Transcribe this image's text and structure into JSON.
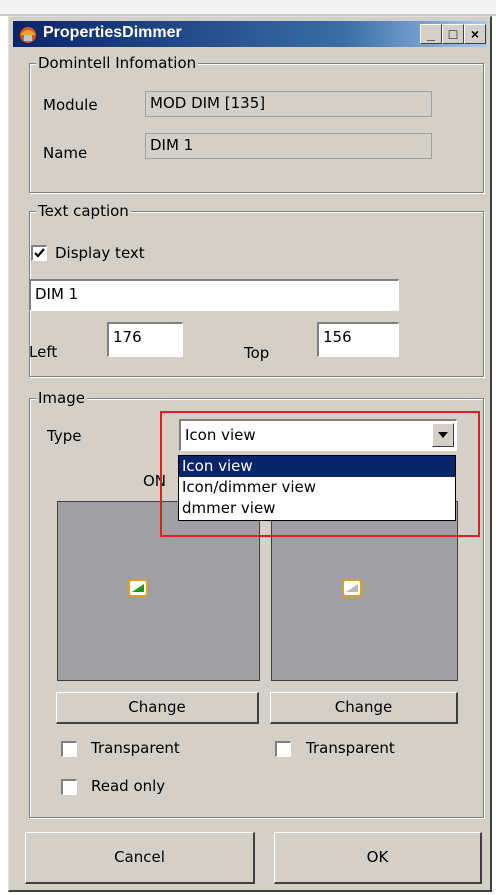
{
  "window": {
    "title": "PropertiesDimmer",
    "minimize": "_",
    "maximize": "□",
    "close": "×"
  },
  "info": {
    "legend": "Domintell Infomation",
    "module_label": "Module",
    "module_value": "MOD DIM [135]",
    "name_label": "Name",
    "name_value": "DIM 1"
  },
  "text": {
    "legend": "Text caption",
    "display_label": "Display text",
    "display_checked": true,
    "caption_value": "DIM 1",
    "left_label": "Left",
    "left_value": "176",
    "top_label": "Top",
    "top_value": "156"
  },
  "image": {
    "legend": "Image",
    "type_label": "Type",
    "type_value": "Icon view",
    "options": [
      "Icon view",
      "Icon/dimmer view",
      "dmmer view"
    ],
    "on_label": "ON",
    "change_label": "Change",
    "change2_label": "Change",
    "transparent_label": "Transparent",
    "transparent2_label": "Transparent",
    "readonly_label": "Read only"
  },
  "buttons": {
    "cancel": "Cancel",
    "ok": "OK"
  },
  "colors": {
    "titlebar": "#0a246a",
    "dialog": "#d4d0c8",
    "highlight_box": "#e02020",
    "icon_on": "#1a9a1a"
  }
}
